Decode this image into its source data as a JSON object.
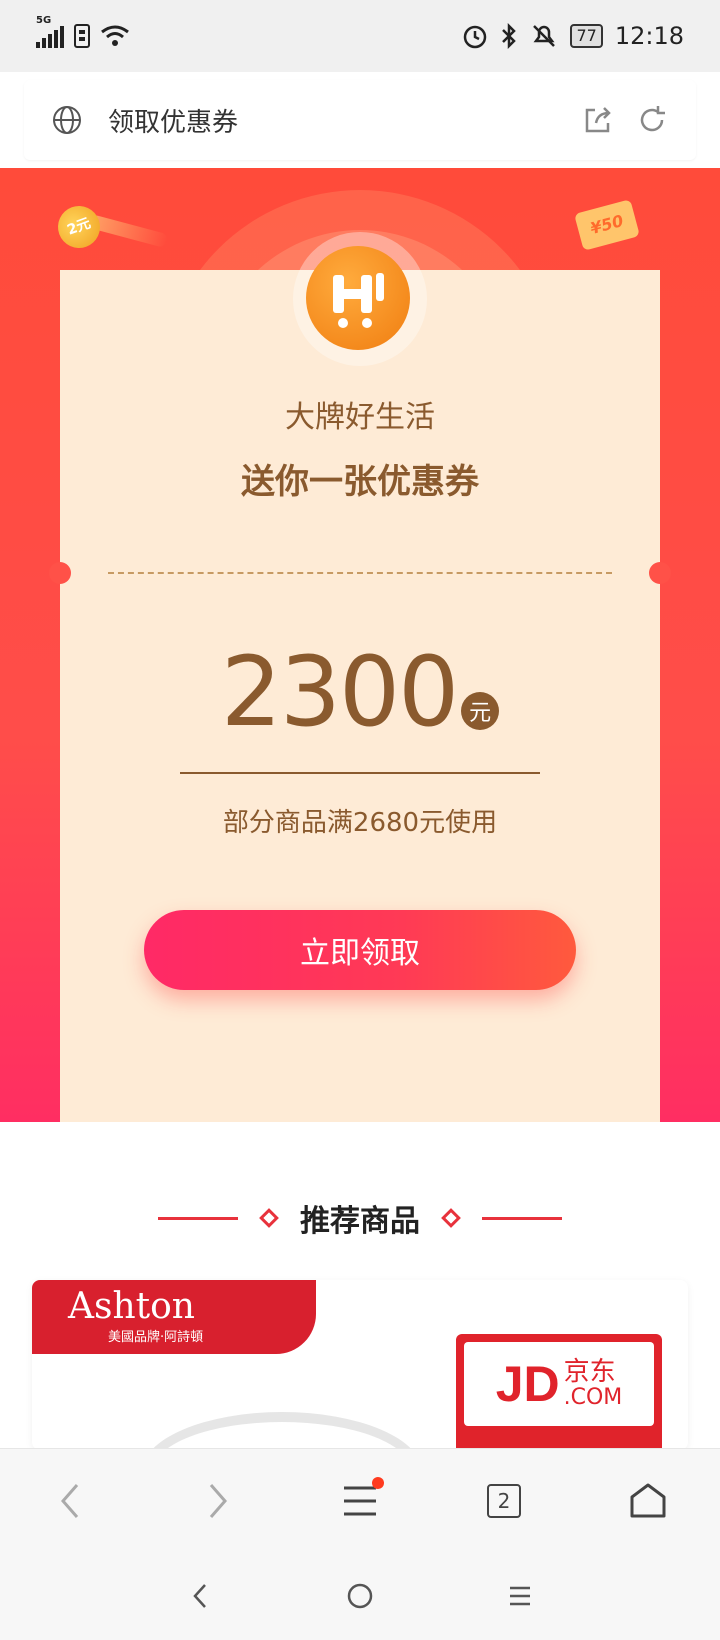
{
  "status_bar": {
    "network": "5G",
    "battery": "77",
    "time": "12:18",
    "icons": [
      "signal-icon",
      "sim-icon",
      "wifi-icon",
      "alarm-icon",
      "bluetooth-icon",
      "mute-icon",
      "battery-icon"
    ]
  },
  "address_bar": {
    "title": "领取优惠券",
    "icons": [
      "globe-icon",
      "share-icon",
      "refresh-icon"
    ]
  },
  "hero": {
    "coin_label": "2元",
    "money_label": "¥50"
  },
  "coupon": {
    "brand_line": "大牌好生活",
    "headline": "送你一张优惠券",
    "amount": "2300",
    "unit": "元",
    "condition": "部分商品满2680元使用",
    "claim_button": "立即领取"
  },
  "recommend": {
    "title": "推荐商品",
    "product": {
      "brand_name": "Ashton",
      "brand_sub": "美國品牌·阿詩頓",
      "badge_logo": "JD",
      "badge_cn": "京东",
      "badge_com": ".COM"
    }
  },
  "browser_nav": {
    "tab_count": "2",
    "items": [
      "back-icon",
      "forward-icon",
      "menu-icon",
      "tabs-icon",
      "home-icon"
    ]
  },
  "system_nav": {
    "items": [
      "back-icon",
      "home-circle-icon",
      "recents-icon"
    ]
  },
  "colors": {
    "hero_red": "#ff4b3a",
    "coupon_bg": "#feebd6",
    "coupon_text": "#8a5a2e",
    "accent": "#ff2966",
    "jd_red": "#e0232b"
  }
}
